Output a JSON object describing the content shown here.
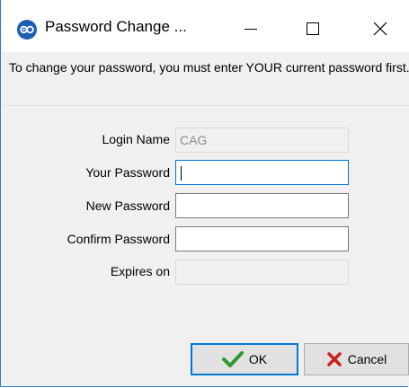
{
  "window": {
    "title": "Password Change ...",
    "icon": "app-logo-icon"
  },
  "titlebar_buttons": {
    "minimize_icon": "minimize-icon",
    "maximize_icon": "maximize-icon",
    "close_icon": "close-icon"
  },
  "instructions": "To change your password, you must enter YOUR current password first.",
  "form": {
    "login_name": {
      "label": "Login Name",
      "value": "CAG",
      "enabled": false
    },
    "your_password": {
      "label": "Your Password",
      "value": "",
      "focused": true
    },
    "new_password": {
      "label": "New Password",
      "value": ""
    },
    "confirm_password": {
      "label": "Confirm Password",
      "value": ""
    },
    "expires_on": {
      "label": "Expires on",
      "value": "",
      "enabled": false
    }
  },
  "buttons": {
    "ok": {
      "label": "OK",
      "icon": "checkmark-icon",
      "color": "#2e9a2e"
    },
    "cancel": {
      "label": "Cancel",
      "icon": "x-mark-icon",
      "color": "#c8221c"
    }
  },
  "colors": {
    "accent": "#0078d7",
    "dialog_background": "#f0f0f0",
    "app_icon": "#1d5fb0"
  }
}
